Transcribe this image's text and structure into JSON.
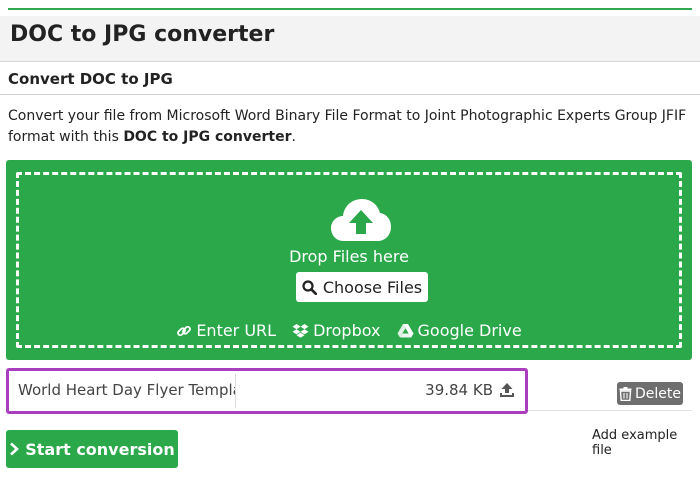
{
  "header": {
    "title": "DOC to JPG converter"
  },
  "section": {
    "subtitle": "Convert DOC to JPG"
  },
  "description": {
    "part1": "Convert your file from Microsoft Word Binary File Format to Joint Photographic Experts Group JFIF format with this ",
    "bold": "DOC to JPG converter",
    "part2": "."
  },
  "dropzone": {
    "drop_text": "Drop Files here",
    "choose_label": "Choose Files",
    "sources": {
      "url": "Enter URL",
      "dropbox": "Dropbox",
      "gdrive": "Google Drive"
    }
  },
  "file": {
    "name": "World Heart Day Flyer Template.doc",
    "size": "39.84 KB",
    "delete_label": "Delete"
  },
  "actions": {
    "start_label": "Start conversion",
    "add_example": "Add example file"
  },
  "colors": {
    "accent": "#2aa84a",
    "highlight": "#a93fbf",
    "delete_bg": "#6e6e6e"
  },
  "icons": [
    "cloud-upload-icon",
    "search-icon",
    "link-icon",
    "dropbox-icon",
    "google-drive-icon",
    "upload-arrow-icon",
    "trash-icon",
    "chevron-right-icon"
  ]
}
